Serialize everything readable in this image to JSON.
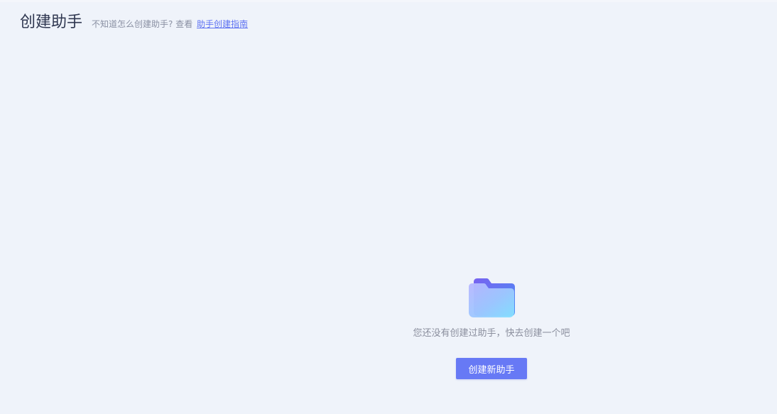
{
  "header": {
    "title": "创建助手",
    "hint_prefix": "不知道怎么创建助手? 查看",
    "guide_link": "助手创建指南"
  },
  "empty_state": {
    "icon": "folder-icon",
    "message": "您还没有创建过助手，快去创建一个吧",
    "create_button": "创建新助手"
  },
  "colors": {
    "background": "#eff3fa",
    "accent": "#6779f5",
    "link": "#5f73f2",
    "title": "#2f3750",
    "muted_text": "#8b8f9e"
  }
}
